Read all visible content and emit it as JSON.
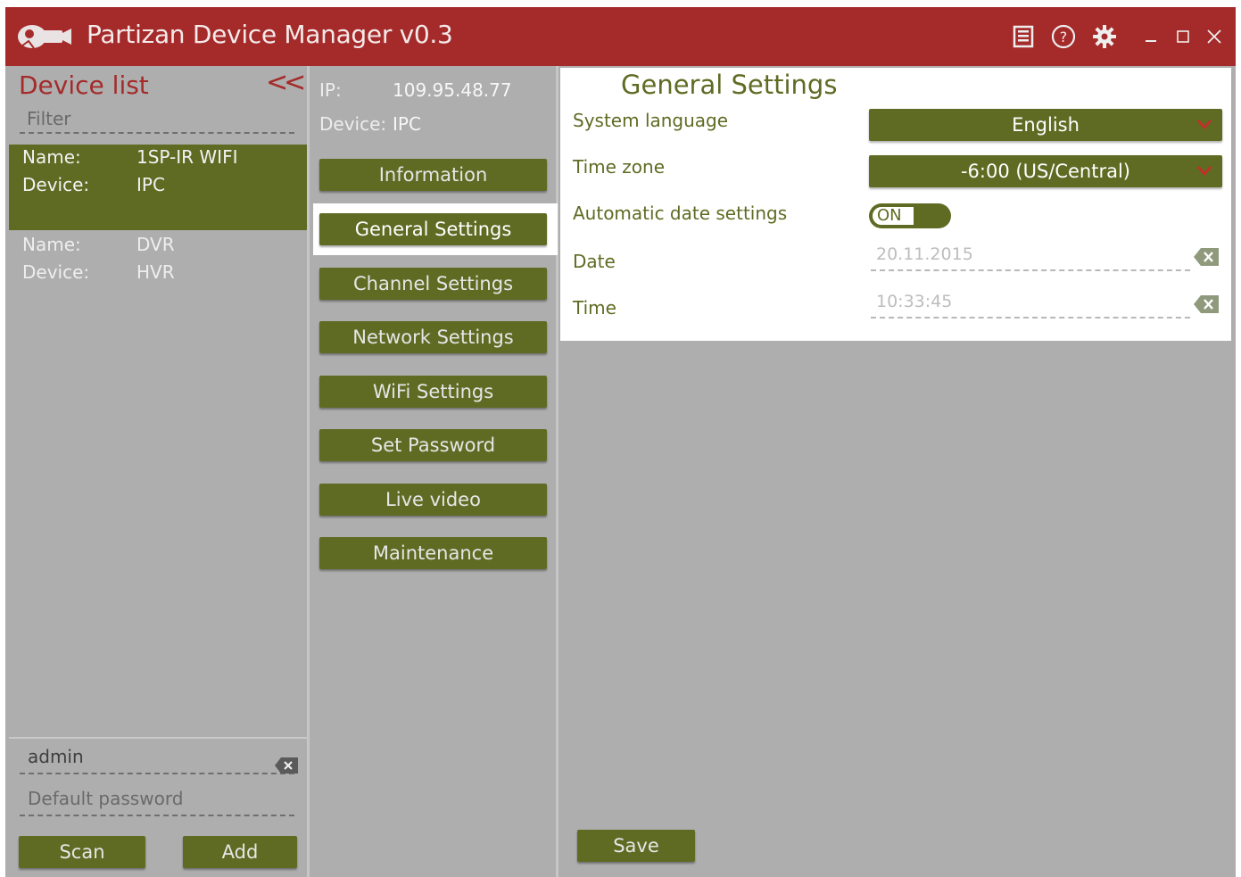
{
  "app": {
    "title": "Partizan Device Manager v0.3",
    "colors": {
      "accent": "#a52a2a",
      "button": "#5f6b23",
      "panel": "#aeaeae"
    },
    "titlebar_icons": [
      "book-icon",
      "help-icon",
      "gear-icon",
      "minimize-icon",
      "maximize-icon",
      "close-icon"
    ]
  },
  "device_list": {
    "title": "Device list",
    "collapse_label": "<<",
    "filter_placeholder": "Filter",
    "devices": [
      {
        "name_label": "Name:",
        "name": "1SP-IR WIFI",
        "device_label": "Device:",
        "device": "IPC",
        "selected": true
      },
      {
        "name_label": "Name:",
        "name": "DVR",
        "device_label": "Device:",
        "device": "HVR",
        "selected": false
      }
    ],
    "username": "admin",
    "password_placeholder": "Default password",
    "scan_label": "Scan",
    "add_label": "Add"
  },
  "device_info": {
    "ip_label": "IP:",
    "ip": "109.95.48.77",
    "device_label": "Device:",
    "device": "IPC"
  },
  "menu": {
    "items": [
      "Information",
      "General Settings",
      "Channel Settings",
      "Network Settings",
      "WiFi Settings",
      "Set Password",
      "Live video",
      "Maintenance"
    ],
    "active": "General Settings"
  },
  "general_settings": {
    "title": "General Settings",
    "language_label": "System language",
    "language_value": "English",
    "timezone_label": "Time zone",
    "timezone_value": "-6:00 (US/Central)",
    "auto_date_label": "Automatic date settings",
    "auto_date_state": "ON",
    "date_label": "Date",
    "date_value": "20.11.2015",
    "time_label": "Time",
    "time_value": "10:33:45",
    "save_label": "Save"
  }
}
